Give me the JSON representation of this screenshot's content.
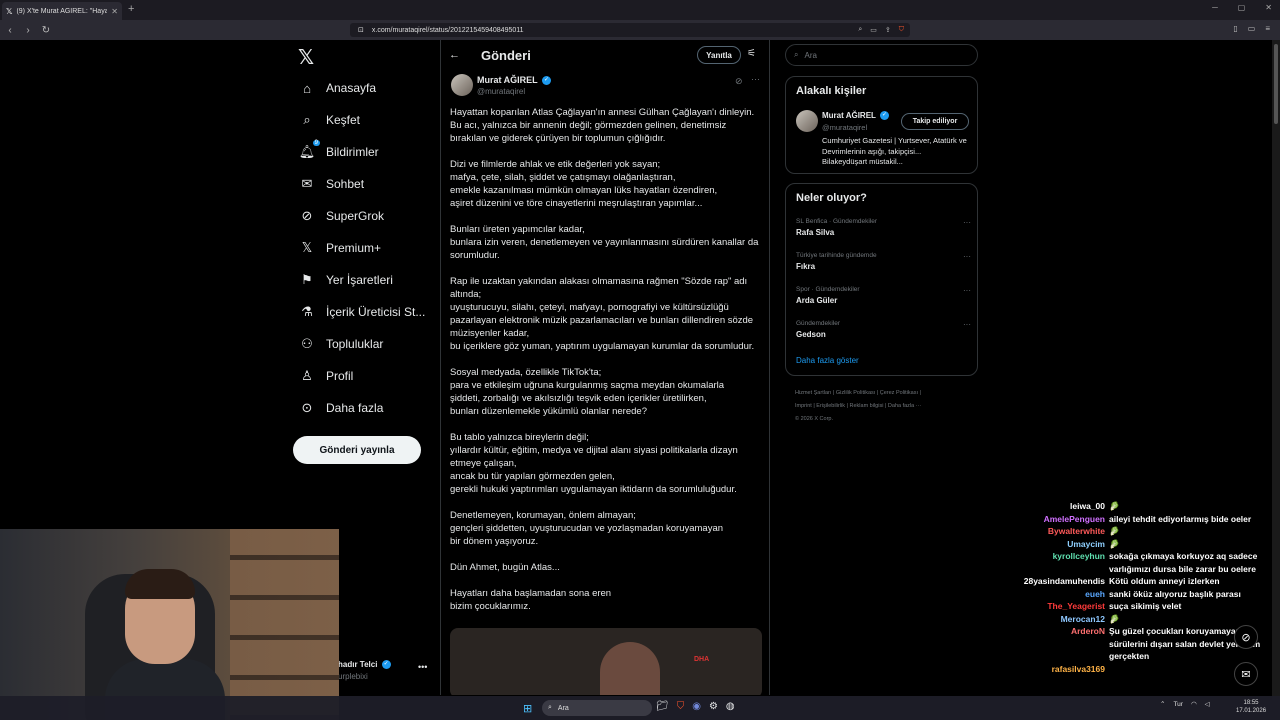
{
  "browser": {
    "tab_title": "(9) X'te Murat AĞIREL: \"Hayattan",
    "url": "x.com/murataqirel/status/2012215459408495011"
  },
  "sidebar": {
    "items": [
      {
        "label": "Anasayfa",
        "icon": "home-icon"
      },
      {
        "label": "Keşfet",
        "icon": "search-icon"
      },
      {
        "label": "Bildirimler",
        "icon": "bell-icon",
        "badge": "9"
      },
      {
        "label": "Sohbet",
        "icon": "mail-icon"
      },
      {
        "label": "SuperGrok",
        "icon": "grok-icon"
      },
      {
        "label": "Premium+",
        "icon": "x-icon"
      },
      {
        "label": "Yer İşaretleri",
        "icon": "bookmark-icon"
      },
      {
        "label": "İçerik Üreticisi St...",
        "icon": "flask-icon"
      },
      {
        "label": "Topluluklar",
        "icon": "people-icon"
      },
      {
        "label": "Profil",
        "icon": "person-icon"
      },
      {
        "label": "Daha fazla",
        "icon": "more-circle-icon"
      }
    ],
    "post_button": "Gönderi yayınla",
    "account_name": "hadır Telci",
    "account_handle": "urplebixi"
  },
  "main": {
    "title": "Gönderi",
    "reply_button": "Yanıtla",
    "author_name": "Murat AĞIREL",
    "author_handle": "@murataqirel",
    "paragraphs": [
      "Hayattan koparılan Atlas Çağlayan'ın annesi Gülhan Çağlayan'ı dinleyin.\nBu acı, yalnızca bir annenin değil; görmezden gelinen, denetimsiz\nbırakılan ve giderek çürüyen bir toplumun çığlığıdır.",
      "Dizi ve filmlerde ahlak ve etik değerleri yok sayan;\nmafya, çete, silah, şiddet ve çatışmayı olağanlaştıran,\nemekle kazanılması mümkün olmayan lüks hayatları özendiren,\naşiret düzenini ve töre cinayetlerini meşrulaştıran yapımlar...",
      "Bunları üreten yapımcılar kadar,\nbunlara izin veren, denetlemeyen ve yayınlanmasını sürdüren kanallar da\nsorumludur.",
      "Rap ile uzaktan yakından alakası olmamasına rağmen \"Sözde rap\" adı\naltında;\nuyuşturucuyu, silahı, çeteyi, mafyayı, pornografiyi ve kültürsüzlüğü\npazarlayan elektronik müzik pazarlamacıları ve bunları dillendiren sözde\nmüzisyenler kadar,\nbu içeriklere göz yuman, yaptırım uygulamayan kurumlar da sorumludur.",
      "Sosyal medyada, özellikle TikTok'ta;\npara ve etkileşim uğruna kurgulanmış saçma meydan okumalarla\nşiddeti, zorbalığı ve akılsızlığı teşvik eden içerikler üretilirken,\nbunları düzenlemekle yükümlü olanlar nerede?",
      "Bu tablo yalnızca bireylerin değil;\nyıllardır kültür, eğitim, medya ve dijital alanı siyasi politikalarla dizayn\netmeye çalışan,\nancak bu tür yapıları görmezden gelen,\ngerekli hukuki yaptırımları uygulamayan iktidarın da sorumluluğudur.",
      "Denetlemeyen, korumayan, önlem almayan;\ngençleri şiddetten, uyuşturucudan ve yozlaşmadan koruyamayan\nbir dönem yaşıyoruz.",
      "Dün Ahmet, bugün Atlas...",
      "Hayatları daha başlamadan sona eren\nbizim çocuklarımız."
    ],
    "media_tag": "DHA"
  },
  "right": {
    "search_placeholder": "Ara",
    "related_title": "Alakalı kişiler",
    "related_name": "Murat AĞIREL",
    "related_handle": "@murataqirel",
    "follow_button": "Takip ediliyor",
    "related_bio": "Cumhuriyet Gazetesi | Yurtsever, Atatürk ve Devrimlerinin aşığı, takipçisi... Bilakeydüşart müstakil...",
    "trends_title": "Neler oluyor?",
    "trends": [
      {
        "meta": "SL Benfica · Gündemdekiler",
        "name": "Rafa Silva"
      },
      {
        "meta": "Türkiye tarihinde gündemde",
        "name": "Fıkra"
      },
      {
        "meta": "Spor · Gündemdekiler",
        "name": "Arda Güler"
      },
      {
        "meta": "Gündemdekiler",
        "name": "Gedson"
      }
    ],
    "show_more": "Daha fazla göster",
    "footer_line1": "Hizmet Şartları  |  Gizlilik Politikası  |  Çerez Politikası  |",
    "footer_line2": "Imprint  |  Erişilebilirlik  |  Reklam bilgisi  |  Daha fazla ···",
    "footer_line3": "© 2026 X Corp."
  },
  "chat": [
    {
      "user": "leiwa_00",
      "color": "#ffffff",
      "msg": "🥬"
    },
    {
      "user": "AmelePenguen",
      "color": "#d070ff",
      "msg": "aileyi tehdit ediyorlarmış bide oeler"
    },
    {
      "user": "Bywalterwhite",
      "color": "#ff5a5a",
      "msg": "🥬"
    },
    {
      "user": "Umaycim",
      "color": "#8fd0ff",
      "msg": "🥬"
    },
    {
      "user": "kyrollceyhun",
      "color": "#5fe0b0",
      "msg": "sokağa çıkmaya korkuyoz aq sadece varlığımızı dursa bile zarar bu oelere"
    },
    {
      "user": "28yasindamuhendis",
      "color": "#ffffff",
      "msg": "Kötü oldum anneyi izlerken"
    },
    {
      "user": "eueh",
      "color": "#5aa8ff",
      "msg": "sanki öküz alıyoruz başlık parası"
    },
    {
      "user": "The_Yeagerist",
      "color": "#ff3b3b",
      "msg": "suça sikimiş velet"
    },
    {
      "user": "Merocan12",
      "color": "#8fc8ff",
      "msg": "🥬"
    },
    {
      "user": "ArderoN",
      "color": "#ff7070",
      "msg": "Şu güzel çocukları koruyamayan it sürülerini dışarı salan devlet yemişim gerçekten"
    },
    {
      "user": "rafasilva3169",
      "color": "#ffb347",
      "msg": ""
    }
  ],
  "taskbar": {
    "search": "Ara",
    "weather": "Tur",
    "time": "18:55",
    "date": "17.01.2026"
  }
}
